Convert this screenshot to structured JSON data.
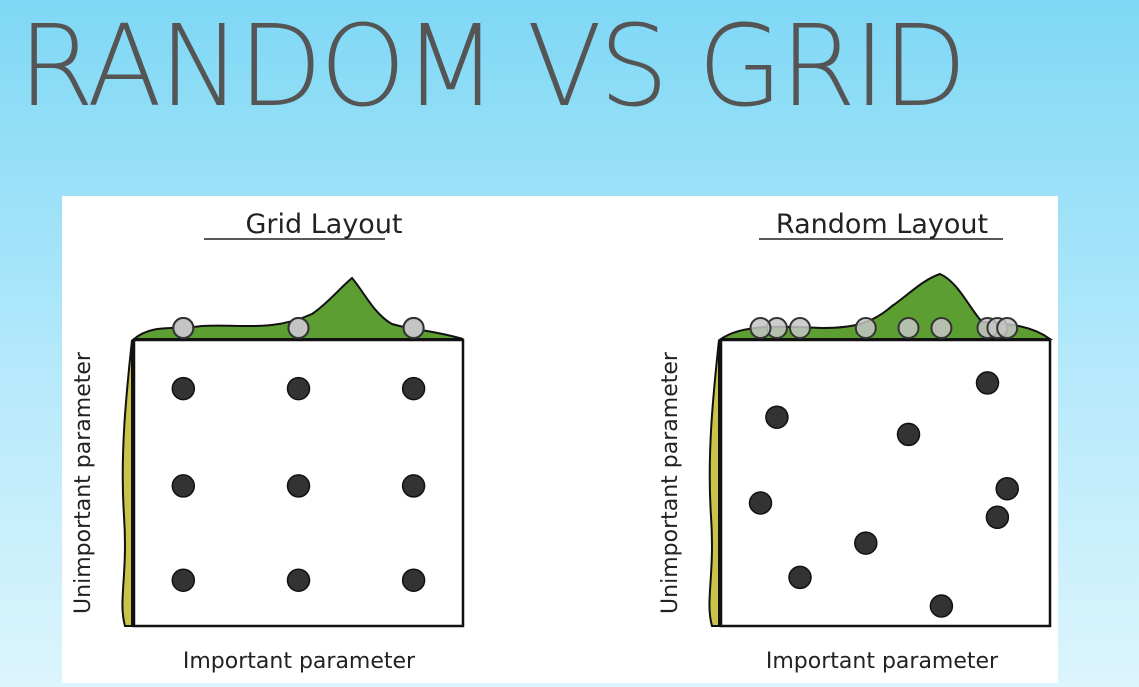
{
  "slide": {
    "title": "RANDOM VS GRID"
  },
  "figure": {
    "panels": [
      {
        "title": "Grid Layout",
        "xlabel": "Important parameter",
        "ylabel": "Unimportant parameter",
        "samples": [
          [
            0.15,
            0.83
          ],
          [
            0.5,
            0.83
          ],
          [
            0.85,
            0.83
          ],
          [
            0.15,
            0.49
          ],
          [
            0.5,
            0.49
          ],
          [
            0.85,
            0.49
          ],
          [
            0.15,
            0.16
          ],
          [
            0.5,
            0.16
          ],
          [
            0.85,
            0.16
          ]
        ]
      },
      {
        "title": "Random Layout",
        "xlabel": "Important parameter",
        "ylabel": "Unimportant parameter",
        "samples": [
          [
            0.17,
            0.73
          ],
          [
            0.12,
            0.43
          ],
          [
            0.24,
            0.17
          ],
          [
            0.44,
            0.29
          ],
          [
            0.57,
            0.67
          ],
          [
            0.67,
            0.07
          ],
          [
            0.81,
            0.85
          ],
          [
            0.84,
            0.38
          ],
          [
            0.87,
            0.48
          ]
        ]
      }
    ],
    "colors": {
      "sample": "#333333",
      "projection": "#c4c4c4",
      "important_density": "#5c9e31",
      "unimportant_density": "#c9c34a"
    }
  }
}
